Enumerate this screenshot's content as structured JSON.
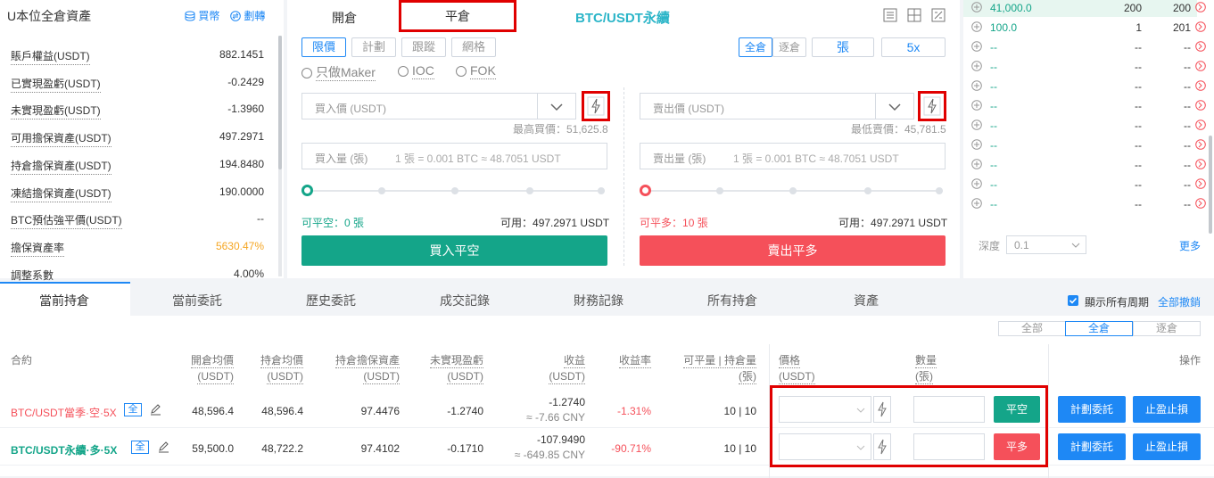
{
  "account": {
    "title": "U本位全倉資產",
    "buy": "買幣",
    "transfer": "劃轉",
    "rows": [
      {
        "label": "賬戶權益(USDT)",
        "value": "882.1451"
      },
      {
        "label": "已實現盈虧(USDT)",
        "value": "-0.2429"
      },
      {
        "label": "未實現盈虧(USDT)",
        "value": "-1.3960"
      },
      {
        "label": "可用擔保資產(USDT)",
        "value": "497.2971"
      },
      {
        "label": "持倉擔保資產(USDT)",
        "value": "194.8480"
      },
      {
        "label": "凍結擔保資產(USDT)",
        "value": "190.0000"
      },
      {
        "label": "BTC預估強平價(USDT)",
        "value": "--"
      },
      {
        "label": "擔保資產率",
        "value": "5630.47%"
      },
      {
        "label": "調整系數",
        "value": "4.00%"
      }
    ]
  },
  "trade": {
    "tab_open": "開倉",
    "tab_close": "平倉",
    "pair": "BTC/USDT永續",
    "order_types": [
      "限價",
      "計劃",
      "跟蹤",
      "網格"
    ],
    "margin_cross": "全倉",
    "margin_isolated": "逐倉",
    "unit": "張",
    "leverage": "5x",
    "options": [
      "只做Maker",
      "IOC",
      "FOK"
    ],
    "buy": {
      "price_placeholder": "買入價 (USDT)",
      "price_hint": "最高買價：51,625.8",
      "amount_label": "買入量 (張)",
      "amount_hint": "1 張 = 0.001 BTC ≈ 48.7051 USDT",
      "closable_label": "可平空：",
      "closable_value": "0 張",
      "available_label": "可用：",
      "available_value": "497.2971 USDT",
      "button": "買入平空"
    },
    "sell": {
      "price_placeholder": "賣出價 (USDT)",
      "price_hint": "最低賣價：45,781.5",
      "amount_label": "賣出量 (張)",
      "amount_hint": "1 張 = 0.001 BTC ≈ 48.7051 USDT",
      "closable_label": "可平多：",
      "closable_value": "10 張",
      "available_label": "可用：",
      "available_value": "497.2971 USDT",
      "button": "賣出平多"
    }
  },
  "orderbook": {
    "rows": [
      {
        "price": "41,000.0",
        "amount": "200",
        "total": "200"
      },
      {
        "price": "100.0",
        "amount": "1",
        "total": "201"
      },
      {
        "price": "--",
        "amount": "--",
        "total": "--"
      },
      {
        "price": "--",
        "amount": "--",
        "total": "--"
      },
      {
        "price": "--",
        "amount": "--",
        "total": "--"
      },
      {
        "price": "--",
        "amount": "--",
        "total": "--"
      },
      {
        "price": "--",
        "amount": "--",
        "total": "--"
      },
      {
        "price": "--",
        "amount": "--",
        "total": "--"
      },
      {
        "price": "--",
        "amount": "--",
        "total": "--"
      },
      {
        "price": "--",
        "amount": "--",
        "total": "--"
      },
      {
        "price": "--",
        "amount": "--",
        "total": "--"
      }
    ],
    "depth_label": "深度",
    "depth_value": "0.1",
    "more": "更多"
  },
  "bottom": {
    "tabs": [
      "當前持倉",
      "當前委託",
      "歷史委託",
      "成交記錄",
      "財務記錄",
      "所有持倉",
      "資產"
    ],
    "show_all": "顯示所有周期",
    "cancel_all": "全部撤銷",
    "filters": [
      "全部",
      "全倉",
      "逐倉"
    ],
    "headers": {
      "contract": "合約",
      "open_avg": "開倉均價",
      "open_avg_unit": "(USDT)",
      "hold_avg": "持倉均價",
      "hold_avg_unit": "(USDT)",
      "margin": "持倉擔保資產",
      "margin_unit": "(USDT)",
      "unrealized": "未實現盈虧",
      "unrealized_unit": "(USDT)",
      "profit": "收益",
      "profit_unit": "(USDT)",
      "rate": "收益率",
      "closable": "可平量 | 持倉量",
      "closable_unit": "(張)",
      "price": "價格",
      "price_unit": "(USDT)",
      "qty": "數量",
      "qty_unit": "(張)",
      "action": "操作"
    },
    "positions": [
      {
        "contract": "BTC/USDT當季·空·5X",
        "open_avg": "48,596.4",
        "hold_avg": "48,596.4",
        "margin": "97.4476",
        "unrealized": "-1.2740",
        "profit": "-1.2740",
        "profit_cny": "≈ -7.66 CNY",
        "rate": "-1.31%",
        "closable": "10 | 10",
        "close_btn": "平空",
        "plan": "計劃委託",
        "tpsl": "止盈止損"
      },
      {
        "contract": "BTC/USDT永續·多·5X",
        "open_avg": "59,500.0",
        "hold_avg": "48,722.2",
        "margin": "97.4102",
        "unrealized": "-0.1710",
        "profit": "-107.9490",
        "profit_cny": "≈ -649.85 CNY",
        "rate": "-90.71%",
        "closable": "10 | 10",
        "close_btn": "平多",
        "plan": "計劃委託",
        "tpsl": "止盈止損"
      }
    ],
    "cross_tag": "全"
  },
  "colors": {
    "green": "#14a589",
    "red": "#f5505a",
    "blue": "#1e88f5",
    "teal": "#2bb5c8",
    "orange": "#f5a623",
    "highlight": "#e00000"
  }
}
